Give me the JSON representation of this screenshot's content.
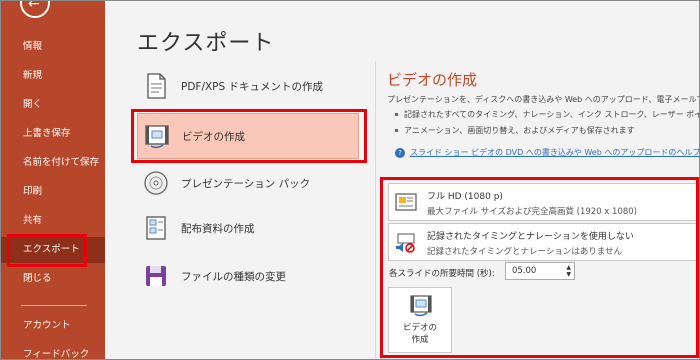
{
  "sidebar": {
    "items": [
      {
        "label": "情報"
      },
      {
        "label": "新規"
      },
      {
        "label": "開く"
      },
      {
        "label": "上書き保存"
      },
      {
        "label": "名前を付けて保存"
      },
      {
        "label": "印刷"
      },
      {
        "label": "共有"
      },
      {
        "label": "エクスポート"
      },
      {
        "label": "閉じる"
      },
      {
        "label": "アカウント"
      },
      {
        "label": "フィードバック"
      }
    ],
    "selected": "エクスポート"
  },
  "page_title": "エクスポート",
  "export_options": [
    {
      "label": "PDF/XPS ドキュメントの作成",
      "icon": "pdf-document-icon"
    },
    {
      "label": "ビデオの作成",
      "icon": "video-icon"
    },
    {
      "label": "プレゼンテーション パック",
      "icon": "cd-icon"
    },
    {
      "label": "配布資料の作成",
      "icon": "handout-icon"
    },
    {
      "label": "ファイルの種類の変更",
      "icon": "save-as-icon"
    }
  ],
  "detail": {
    "title": "ビデオの作成",
    "description": "プレゼンテーションを、ディスクへの書き込みや Web へのアップロード、電子メールでの送",
    "bullets": [
      "記録されたすべてのタイミング、ナレーション、インク ストローク、レーザー ポインター",
      "アニメーション、画面切り替え、およびメディアも保存されます"
    ],
    "help_link": "スライド ショー ビデオの DVD への書き込みや Web へのアップロードのヘルプ",
    "quality": {
      "main": "フル HD (1080 p)",
      "sub": "最大ファイル サイズおよび完全高画質 (1920 x 1080)"
    },
    "timing": {
      "main": "記録されたタイミングとナレーションを使用しない",
      "sub": "記録されたタイミングとナレーションはありません"
    },
    "seconds_label": "各スライドの所要時間 (秒):",
    "seconds_value": "05.00",
    "create_button": "ビデオの\n作成"
  },
  "colors": {
    "sidebar": "#b7472a",
    "accent": "#c4462a",
    "highlight": "#e8000b",
    "selected_option": "#f8c7b7"
  }
}
